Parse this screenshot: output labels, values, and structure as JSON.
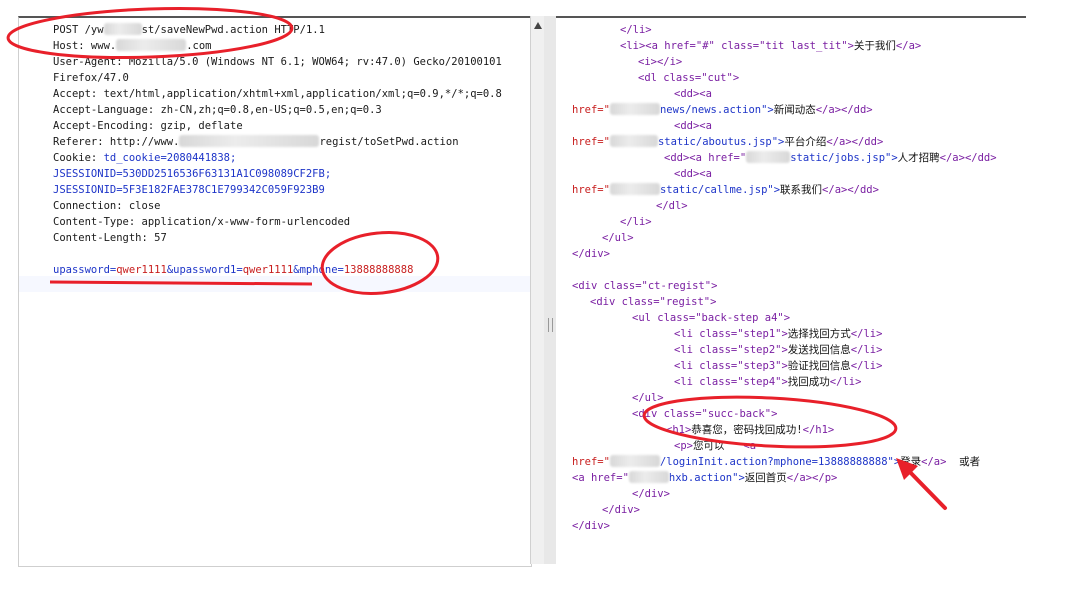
{
  "request": {
    "lines": [
      {
        "parts": [
          "POST /yw",
          "st/saveNewPwd.action HTTP/1.1"
        ]
      },
      {
        "parts": [
          "Host: www.",
          ".com"
        ]
      },
      {
        "parts": [
          "User-Agent: Mozilla/5.0 (Windows NT 6.1; WOW64; rv:47.0) Gecko/20100101"
        ]
      },
      {
        "parts": [
          "Firefox/47.0"
        ]
      },
      {
        "parts": [
          "Accept: text/html,application/xhtml+xml,application/xml;q=0.9,*/*;q=0.8"
        ]
      },
      {
        "parts": [
          "Accept-Language: zh-CN,zh;q=0.8,en-US;q=0.5,en;q=0.3"
        ]
      },
      {
        "parts": [
          "Accept-Encoding: gzip, deflate"
        ]
      },
      {
        "parts": [
          "Referer: http://www.",
          "regist/toSetPwd.action"
        ]
      },
      {
        "parts": [
          "Cookie: ",
          "td_cookie=2080441838;"
        ]
      },
      {
        "parts": [
          "JSESSIONID=530DD2516536F63131A1C098089CF2FB;"
        ]
      },
      {
        "parts": [
          "JSESSIONID=5F3E182FAE378C1E799342C059F923B9"
        ]
      },
      {
        "parts": [
          "Connection: close"
        ]
      },
      {
        "parts": [
          "Content-Type: application/x-www-form-urlencoded"
        ]
      },
      {
        "parts": [
          "Content-Length: 57"
        ]
      }
    ],
    "body": {
      "k1": "upassword",
      "v1": "qwer1111",
      "k2": "upassword1",
      "v2": "qwer1111",
      "k3": "mphone",
      "v3": "13888888888"
    }
  },
  "response": {
    "l0": "</li>",
    "l1a": "<li>",
    "l1b": "<a href=\"#\" class=\"tit last_tit\">",
    "l1c": "关于我们",
    "l1d": "</a>",
    "l2": "<i></i>",
    "l3a": "<dl class=\"cut\">",
    "l4": "<dd><a",
    "l5a": "href=\"",
    "l5b": "news/news.action\">",
    "l5c": "新闻动态",
    "l5d": "</a></dd>",
    "l6": "<dd><a",
    "l7a": "href=\"",
    "l7b": "static/aboutus.jsp\">",
    "l7c": "平台介绍",
    "l7d": "</a></dd>",
    "l8a": "<dd><a href=\"",
    "l8b": "static/jobs.jsp\">",
    "l8c": "人才招聘",
    "l8d": "</a></dd>",
    "l9": "<dd><a",
    "l10a": "href=\"",
    "l10b": "static/callme.jsp\">",
    "l10c": "联系我们",
    "l10d": "</a></dd>",
    "l11": "</dl>",
    "l12": "</li>",
    "l13": "</ul>",
    "l14": "</div>",
    "l16": "<div class=\"ct-regist\">",
    "l17": "<div class=\"regist\">",
    "l18": "<ul class=\"back-step a4\">",
    "l19a": "<li class=\"step1\">",
    "l19b": "选择找回方式",
    "l19c": "</li>",
    "l20a": "<li class=\"step2\">",
    "l20b": "发送找回信息",
    "l20c": "</li>",
    "l21a": "<li class=\"step3\">",
    "l21b": "验证找回信息",
    "l21c": "</li>",
    "l22a": "<li class=\"step4\">",
    "l22b": "找回成功",
    "l22c": "</li>",
    "l23": "</ul>",
    "l24": "<div class=\"succ-back\">",
    "l25a": "<h1>",
    "l25b": "恭喜您，密码找回成功!",
    "l25c": "</h1>",
    "l26a": "<p>",
    "l26b": "您可以",
    "l26c": "<a",
    "l27a": "href=\"",
    "l27b": "/loginInit.action?mphone=13888888888\">",
    "l27c": "登录",
    "l27d": "</a>",
    "l27e": "或者",
    "l28a": "<a href=\"",
    "l28b": "hxb.action\">",
    "l28c": "返回首页",
    "l28d": "</a></p>",
    "l29": "</div>",
    "l30": "</div>",
    "l31": "</div>"
  },
  "colors": {
    "annotation": "#e8202a",
    "accent_blue": "#1d34c8"
  }
}
